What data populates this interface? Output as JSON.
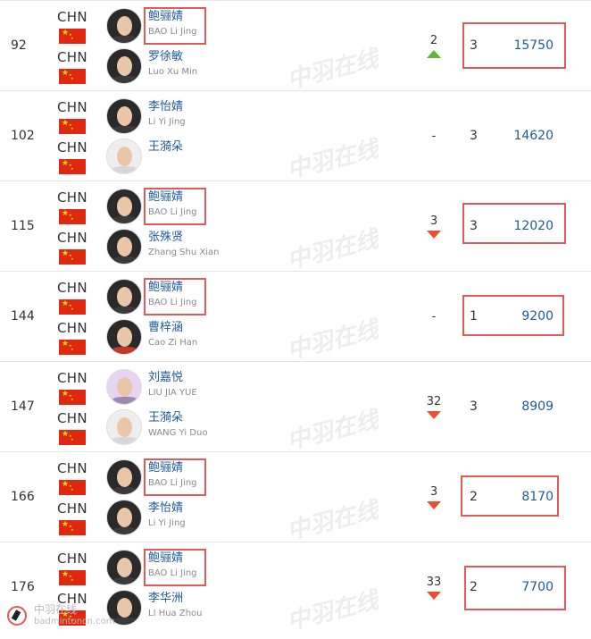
{
  "rows": [
    {
      "rank": "92",
      "p1": {
        "country": "CHN",
        "cn": "鲍骊婧",
        "en": "BAO Li Jing",
        "highlight": true,
        "avatar": "dark"
      },
      "p2": {
        "country": "CHN",
        "cn": "罗徐敏",
        "en": "Luo Xu Min",
        "highlight": false,
        "avatar": "dark"
      },
      "move": "2",
      "trend": "up",
      "tournaments": "3",
      "points": "15750",
      "boxed": true
    },
    {
      "rank": "102",
      "p1": {
        "country": "CHN",
        "cn": "李怡婧",
        "en": "Li Yi Jing",
        "highlight": false,
        "avatar": "dark"
      },
      "p2": {
        "country": "CHN",
        "cn": "王漪朵",
        "en": "",
        "highlight": false,
        "avatar": "light"
      },
      "move": "-",
      "trend": "none",
      "tournaments": "3",
      "points": "14620",
      "boxed": false
    },
    {
      "rank": "115",
      "p1": {
        "country": "CHN",
        "cn": "鲍骊婧",
        "en": "BAO Li Jing",
        "highlight": true,
        "avatar": "dark"
      },
      "p2": {
        "country": "CHN",
        "cn": "张殊贤",
        "en": "Zhang Shu Xian",
        "highlight": false,
        "avatar": "dark"
      },
      "move": "3",
      "trend": "down",
      "tournaments": "3",
      "points": "12020",
      "boxed": true
    },
    {
      "rank": "144",
      "p1": {
        "country": "CHN",
        "cn": "鲍骊婧",
        "en": "BAO Li Jing",
        "highlight": true,
        "avatar": "dark"
      },
      "p2": {
        "country": "CHN",
        "cn": "曹梓涵",
        "en": "Cao Zi Han",
        "highlight": false,
        "avatar": "red"
      },
      "move": "-",
      "trend": "none",
      "tournaments": "1",
      "points": "9200",
      "boxed": true
    },
    {
      "rank": "147",
      "p1": {
        "country": "CHN",
        "cn": "刘嘉悦",
        "en": "LIU JIA YUE",
        "highlight": false,
        "avatar": "purple"
      },
      "p2": {
        "country": "CHN",
        "cn": "王漪朵",
        "en": "WANG Yi Duo",
        "highlight": false,
        "avatar": "light"
      },
      "move": "32",
      "trend": "down",
      "tournaments": "3",
      "points": "8909",
      "boxed": false
    },
    {
      "rank": "166",
      "p1": {
        "country": "CHN",
        "cn": "鲍骊婧",
        "en": "BAO Li Jing",
        "highlight": true,
        "avatar": "dark"
      },
      "p2": {
        "country": "CHN",
        "cn": "李怡婧",
        "en": "Li Yi Jing",
        "highlight": false,
        "avatar": "dark"
      },
      "move": "3",
      "trend": "down",
      "tournaments": "2",
      "points": "8170",
      "boxed": true
    },
    {
      "rank": "176",
      "p1": {
        "country": "CHN",
        "cn": "鲍骊婧",
        "en": "BAO Li Jing",
        "highlight": true,
        "avatar": "dark"
      },
      "p2": {
        "country": "CHN",
        "cn": "李华洲",
        "en": "LI Hua Zhou",
        "highlight": false,
        "avatar": "dark"
      },
      "move": "33",
      "trend": "down",
      "tournaments": "2",
      "points": "7700",
      "boxed": true
    }
  ],
  "watermark": "中羽在线",
  "logo": {
    "line1": "中羽在线",
    "line2": "badmintoncn.com"
  },
  "colors": {
    "link": "#1e5a9c",
    "highlight_box": "#e05a5a",
    "up": "#5ab832",
    "down": "#e8522f",
    "flag": "#de2910"
  }
}
